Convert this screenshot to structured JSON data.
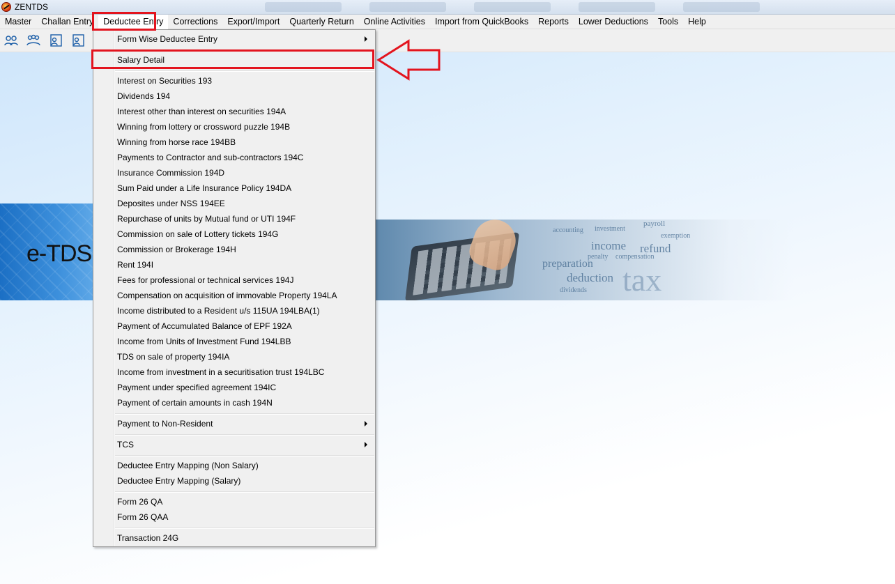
{
  "window": {
    "title": "ZENTDS"
  },
  "menubar": [
    {
      "label": "Master"
    },
    {
      "label": "Challan Entry"
    },
    {
      "label": "Deductee Entry"
    },
    {
      "label": "Corrections"
    },
    {
      "label": "Export/Import"
    },
    {
      "label": "Quarterly Return"
    },
    {
      "label": "Online Activities"
    },
    {
      "label": "Import from QuickBooks"
    },
    {
      "label": "Reports"
    },
    {
      "label": "Lower Deductions"
    },
    {
      "label": "Tools"
    },
    {
      "label": "Help"
    }
  ],
  "toolbar": {
    "icons": [
      "users-icon",
      "group-icon",
      "person-form-icon",
      "person-form-icon"
    ]
  },
  "banner": {
    "text": "e-TDS",
    "words": [
      "payroll",
      "investment",
      "income",
      "refund",
      "preparation",
      "deduction",
      "tax",
      "accounting",
      "penalty",
      "compensation",
      "dividends",
      "exemption"
    ]
  },
  "dropdown": {
    "items": [
      {
        "label": "Form Wise Deductee Entry",
        "submenu": true
      },
      {
        "label": "Salary Detail"
      },
      {
        "label": "Interest on Securities 193"
      },
      {
        "label": "Dividends 194"
      },
      {
        "label": "Interest other than interest on securities 194A"
      },
      {
        "label": "Winning from lottery  or crossword puzzle 194B"
      },
      {
        "label": "Winning from horse race 194BB"
      },
      {
        "label": "Payments to Contractor and sub-contractors 194C"
      },
      {
        "label": "Insurance Commission 194D"
      },
      {
        "label": "Sum Paid under a Life Insurance Policy 194DA"
      },
      {
        "label": "Deposites under NSS 194EE"
      },
      {
        "label": "Repurchase of units by Mutual fund or UTI 194F"
      },
      {
        "label": "Commission on sale of Lottery tickets 194G"
      },
      {
        "label": "Commission or Brokerage 194H"
      },
      {
        "label": "Rent 194I"
      },
      {
        "label": "Fees for professional or technical services 194J"
      },
      {
        "label": "Compensation on acquisition of immovable Property 194LA"
      },
      {
        "label": "Income distributed to a Resident u/s 115UA 194LBA(1)"
      },
      {
        "label": "Payment of Accumulated Balance of EPF 192A"
      },
      {
        "label": "Income from Units of Investment Fund 194LBB"
      },
      {
        "label": "TDS on sale of property 194IA"
      },
      {
        "label": "Income from investment in a securitisation trust 194LBC"
      },
      {
        "label": "Payment under specified agreement 194IC"
      },
      {
        "label": "Payment of certain amounts in cash 194N"
      },
      {
        "label": "Payment to Non-Resident",
        "submenu": true
      },
      {
        "label": "TCS",
        "submenu": true
      },
      {
        "label": "Deductee Entry Mapping (Non Salary)"
      },
      {
        "label": "Deductee Entry Mapping (Salary)"
      },
      {
        "label": "Form 26 QA"
      },
      {
        "label": "Form 26 QAA"
      },
      {
        "label": "Transaction 24G"
      }
    ]
  },
  "colors": {
    "highlight": "#e3141e",
    "menu_bg": "#f0f0f0"
  }
}
